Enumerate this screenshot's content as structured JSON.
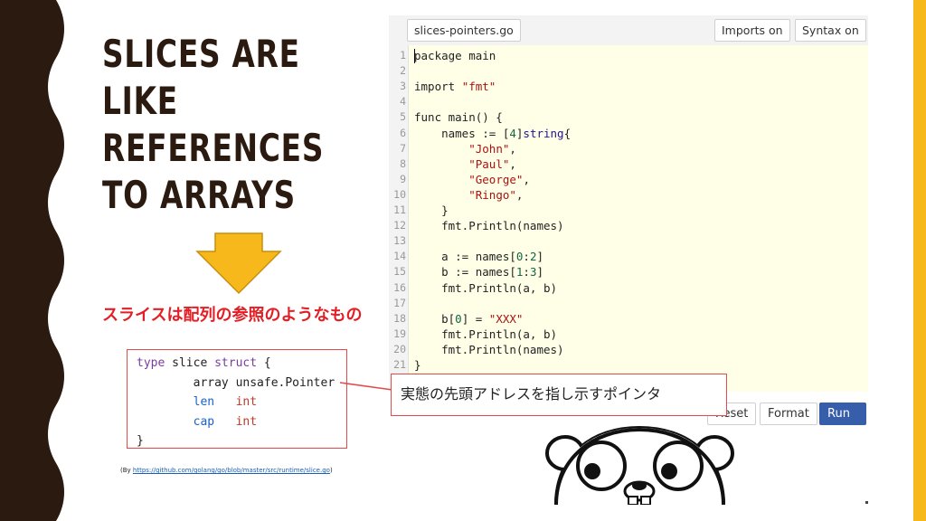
{
  "slide": {
    "title": "SLICES ARE\nLIKE\nREFERENCES\nTO ARRAYS",
    "caption_jp": "スライスは配列の参照のようなもの",
    "source_prefix": "(By ",
    "source_link": "https://github.com/golang/go/blob/master/src/runtime/slice.go",
    "source_suffix": ")",
    "callout_text": "実態の先頭アドレスを指し示すポインタ",
    "colors": {
      "title": "#2a1a10",
      "accent_red": "#e31e24",
      "border_dark": "#2a1a10",
      "stripe_yellow": "#f7b81b",
      "arrow_yellow": "#f7b81b"
    }
  },
  "struct_code": {
    "line1": {
      "kw_type": "type",
      "name": " slice ",
      "kw_struct": "struct",
      "rest": " {"
    },
    "line2": {
      "field": "        array unsafe.Pointer"
    },
    "line3": {
      "field": "len",
      "type": "int"
    },
    "line4": {
      "field": "cap",
      "type": "int"
    },
    "line5": {
      "text": "}"
    }
  },
  "playground": {
    "filename": "slices-pointers.go",
    "imports_button": "Imports on",
    "syntax_button": "Syntax on",
    "reset_button": "Reset",
    "format_button": "Format",
    "run_button": "Run",
    "line_numbers": [
      "1",
      "2",
      "3",
      "4",
      "5",
      "6",
      "7",
      "8",
      "9",
      "10",
      "11",
      "12",
      "13",
      "14",
      "15",
      "16",
      "17",
      "18",
      "19",
      "20",
      "21"
    ],
    "code": {
      "l1": "package main",
      "l3a": "import ",
      "l3b": "\"fmt\"",
      "l5": "func main() {",
      "l6a": "    names := [",
      "l6b": "4",
      "l6c": "]",
      "l6d": "string",
      "l6e": "{",
      "l7": "\"John\"",
      "l7c": ",",
      "l8": "\"Paul\"",
      "l8c": ",",
      "l9": "\"George\"",
      "l9c": ",",
      "l10": "\"Ringo\"",
      "l10c": ",",
      "l11": "    }",
      "l12": "    fmt.Println(names)",
      "l14a": "    a := names[",
      "l14b": "0",
      "l14c": ":",
      "l14d": "2",
      "l14e": "]",
      "l15a": "    b := names[",
      "l15b": "1",
      "l15c": ":",
      "l15d": "3",
      "l15e": "]",
      "l16": "    fmt.Println(a, b)",
      "l18a": "    b[",
      "l18b": "0",
      "l18c": "] = ",
      "l18d": "\"XXX\"",
      "l19": "    fmt.Println(a, b)",
      "l20": "    fmt.Println(names)",
      "l21": "}"
    }
  }
}
